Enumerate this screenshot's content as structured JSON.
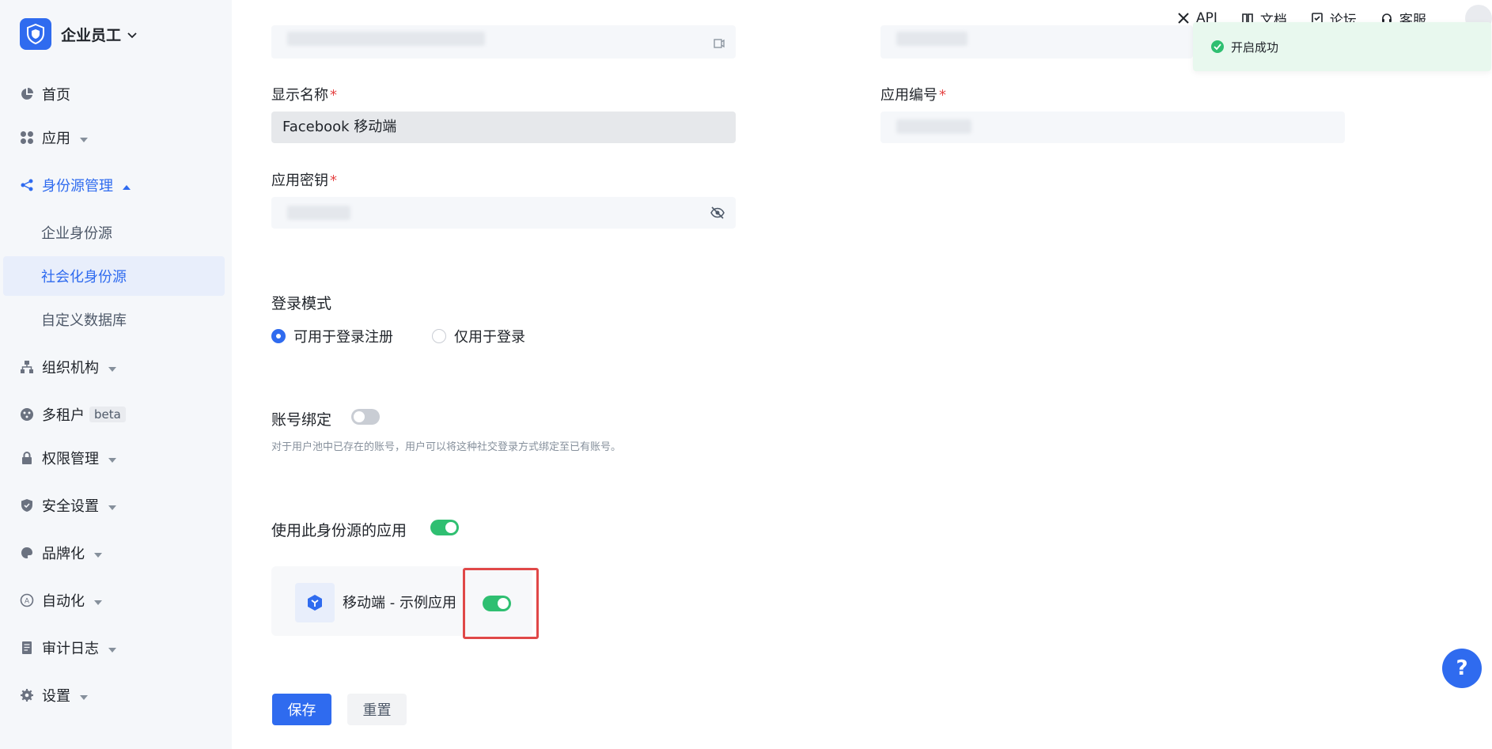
{
  "org": {
    "name": "企业员工"
  },
  "sidebar": {
    "items": [
      {
        "label": "首页"
      },
      {
        "label": "应用"
      },
      {
        "label": "身份源管理"
      },
      {
        "label": "组织机构"
      },
      {
        "label": "多租户",
        "badge": "beta"
      },
      {
        "label": "权限管理"
      },
      {
        "label": "安全设置"
      },
      {
        "label": "品牌化"
      },
      {
        "label": "自动化"
      },
      {
        "label": "审计日志"
      },
      {
        "label": "设置"
      }
    ],
    "sub_items": [
      {
        "label": "企业身份源"
      },
      {
        "label": "社会化身份源",
        "active": true
      },
      {
        "label": "自定义数据库"
      }
    ]
  },
  "topbar": {
    "api": "API",
    "docs": "文档",
    "forum": "论坛",
    "support": "客服"
  },
  "toast": {
    "message": "开启成功"
  },
  "form": {
    "display_name": {
      "label": "显示名称",
      "required": "*",
      "value": "Facebook 移动端"
    },
    "app_id": {
      "label": "应用编号",
      "required": "*"
    },
    "app_secret": {
      "label": "应用密钥",
      "required": "*"
    },
    "login_mode": {
      "title": "登录模式",
      "options": [
        "可用于登录注册",
        "仅用于登录"
      ],
      "selected": "可用于登录注册"
    },
    "account_binding": {
      "title": "账号绑定",
      "enabled": false,
      "hint": "对于用户池中已存在的账号，用户可以将这种社交登录方式绑定至已有账号。"
    },
    "apps_using": {
      "title": "使用此身份源的应用",
      "enabled": true,
      "apps": [
        {
          "name": "移动端 - 示例应用",
          "enabled": true
        }
      ]
    }
  },
  "buttons": {
    "save": "保存",
    "reset": "重置"
  },
  "help": {
    "label": "?"
  },
  "colors": {
    "primary": "#2f6bef",
    "success": "#2fbf71",
    "danger": "#e04848",
    "toast_bg": "#e8f8ee"
  }
}
